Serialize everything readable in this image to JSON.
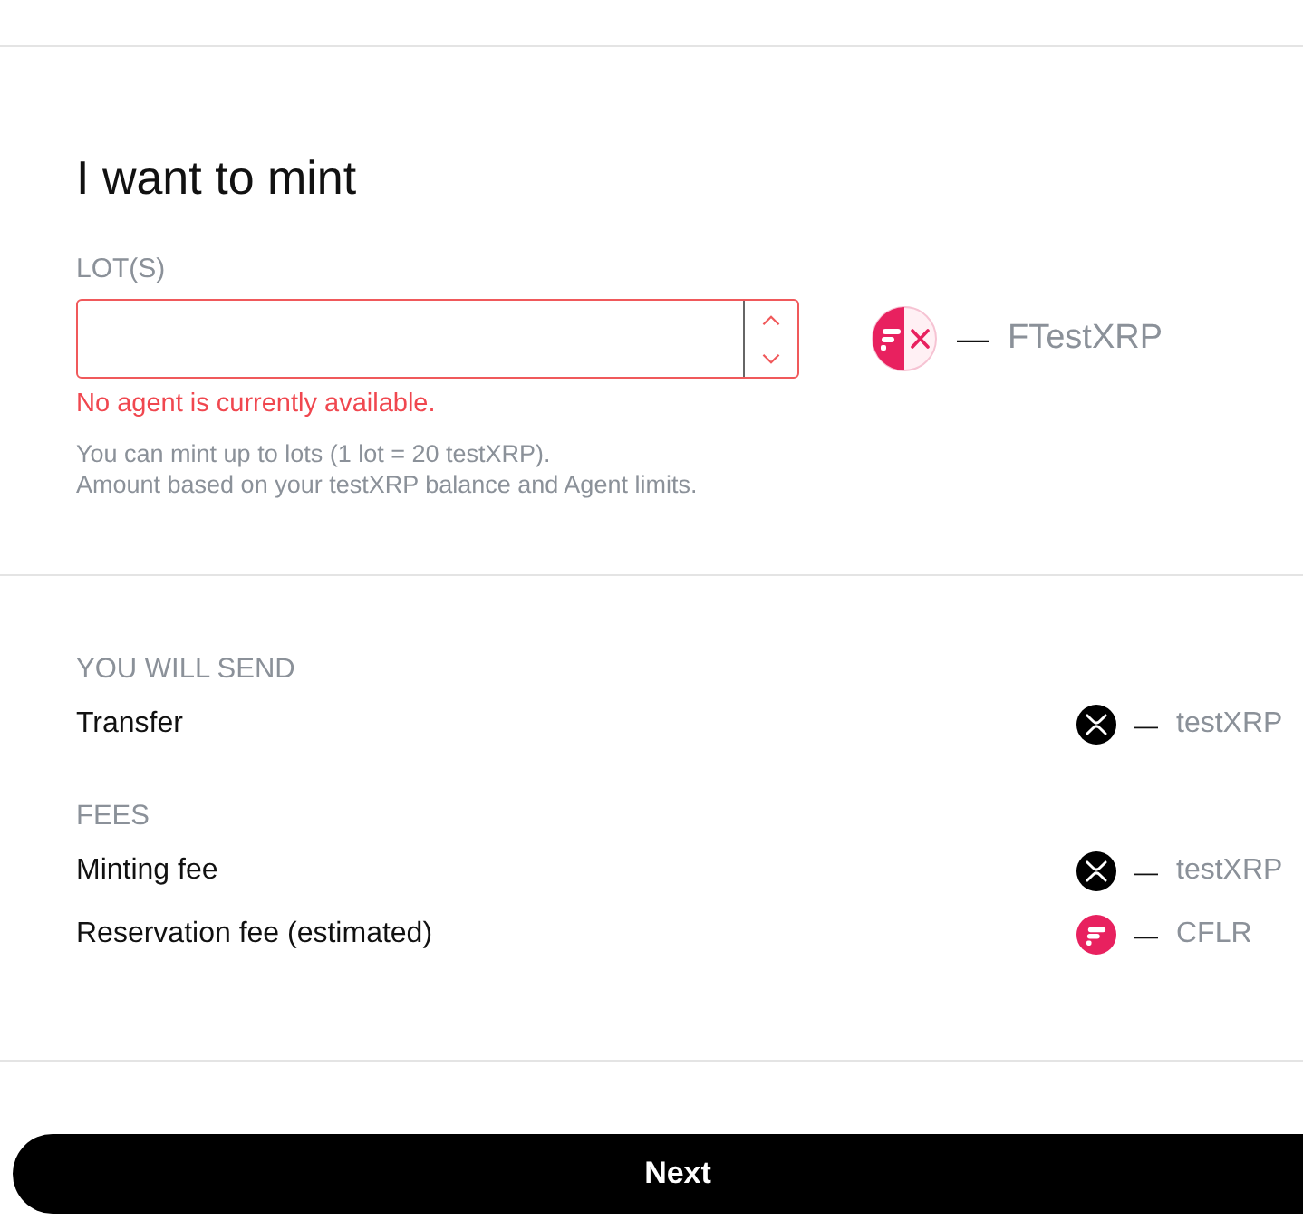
{
  "mint_form": {
    "title": "I want to mint",
    "lots_field": {
      "label": "LOT(S)",
      "invalid": true,
      "error": "No agent is currently available."
    },
    "help": [
      "You can mint up to lots (1 lot = 20 testXRP).",
      "Amount based on your testXRP balance and Agent limits."
    ],
    "receive": {
      "amount": "—",
      "symbol": "FTestXRP"
    }
  },
  "summary": [
    {
      "heading": "YOU WILL SEND",
      "rows": [
        {
          "label": "Transfer",
          "kind": "xrp",
          "amount": "—",
          "symbol": "testXRP"
        }
      ]
    },
    {
      "heading": "FEES",
      "rows": [
        {
          "label": "Minting fee",
          "kind": "xrp",
          "amount": "—",
          "symbol": "testXRP"
        },
        {
          "label": "Reservation fee (estimated)",
          "kind": "flare",
          "amount": "—",
          "symbol": "CFLR"
        }
      ]
    }
  ],
  "next_button": {
    "label": "Next"
  }
}
